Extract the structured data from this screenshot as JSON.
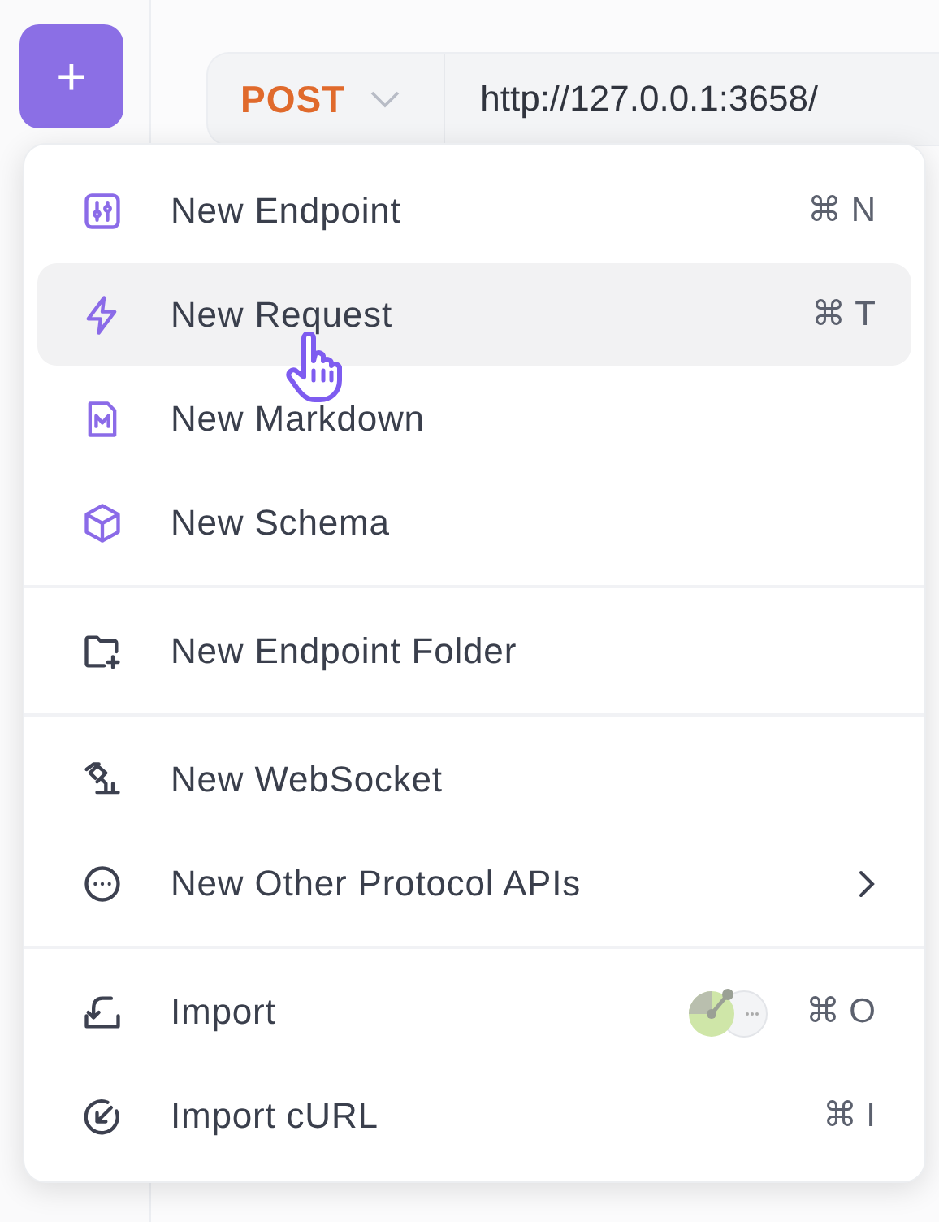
{
  "toolbar": {
    "add_button": {
      "label": "+"
    },
    "request": {
      "method": "POST",
      "url": "http://127.0.0.1:3658/"
    }
  },
  "menu": {
    "groups": [
      {
        "items": [
          {
            "label": "New Endpoint",
            "shortcut": "⌘ N",
            "highlighted": false
          },
          {
            "label": "New Request",
            "shortcut": "⌘ T",
            "highlighted": true
          },
          {
            "label": "New Markdown",
            "highlighted": false
          },
          {
            "label": "New Schema",
            "highlighted": false
          }
        ]
      },
      {
        "items": [
          {
            "label": "New Endpoint Folder",
            "highlighted": false
          }
        ]
      },
      {
        "items": [
          {
            "label": "New WebSocket",
            "highlighted": false
          },
          {
            "label": "New Other Protocol APIs",
            "highlighted": false,
            "has_submenu": true
          }
        ]
      },
      {
        "items": [
          {
            "label": "Import",
            "shortcut": "⌘ O",
            "highlighted": false,
            "integration_badge": true
          },
          {
            "label": "Import cURL",
            "shortcut": "⌘ I",
            "highlighted": false
          }
        ]
      }
    ]
  }
}
